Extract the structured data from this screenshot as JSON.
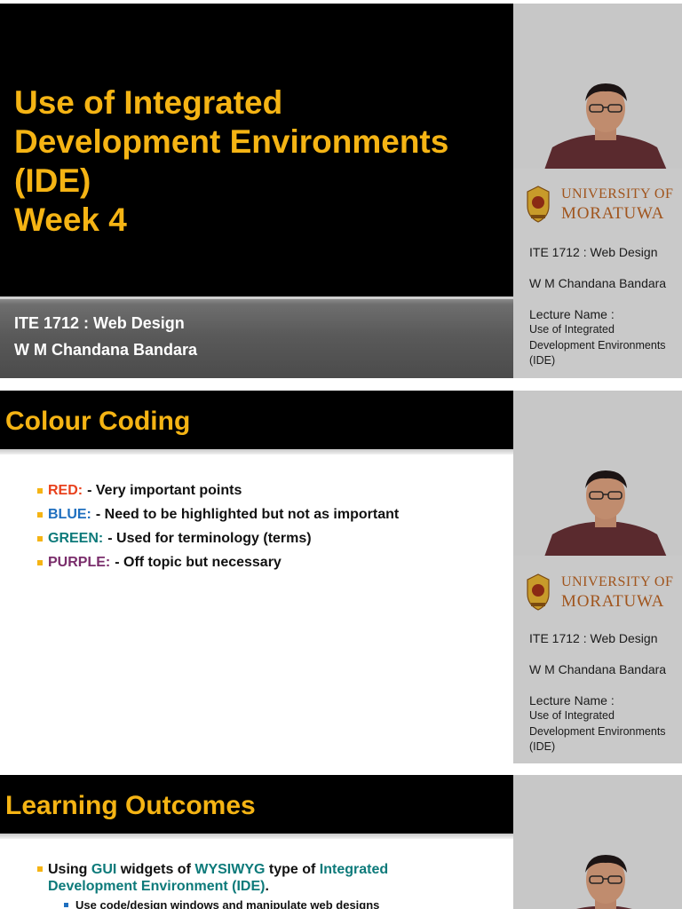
{
  "colors": {
    "title_yellow": "#f5b414",
    "red": "#e8401c",
    "blue": "#1f6fbf",
    "green": "#0d7a7a",
    "purple": "#7a2d6b",
    "university_brown": "#a0541c"
  },
  "side_panel": {
    "university_line1": "UNIVERSITY OF",
    "university_line2": "MORATUWA",
    "course": "ITE 1712 : Web Design",
    "lecturer": "W M Chandana Bandara",
    "lecture_name_label": "Lecture Name :",
    "lecture_name_lines": [
      "Use of Integrated",
      "Development Environments",
      "(IDE)"
    ]
  },
  "slide1": {
    "title_lines": [
      "Use of Integrated",
      "Development Environments",
      "(IDE)",
      "Week 4"
    ],
    "footer_course": "ITE 1712 : Web Design",
    "footer_lecturer": "W M Chandana Bandara"
  },
  "slide2": {
    "heading": "Colour Coding",
    "items": [
      {
        "key": "RED:",
        "text": "- Very important points"
      },
      {
        "key": "BLUE:",
        "text": "- Need to be highlighted but not as important"
      },
      {
        "key": "GREEN:",
        "text": "-  Used for terminology (terms)"
      },
      {
        "key": "PURPLE:",
        "text": "- Off topic but necessary"
      }
    ]
  },
  "slide3": {
    "heading": "Learning Outcomes",
    "outcome1": {
      "p1": "Using ",
      "t1": "GUI",
      "p2": " widgets of ",
      "t2": "WYSIWYG",
      "p3": " type of ",
      "t3": "Integrated",
      "t4": "Development Environment (IDE)",
      "p4": "."
    },
    "sub1": "Use code/design windows and manipulate web designs"
  }
}
